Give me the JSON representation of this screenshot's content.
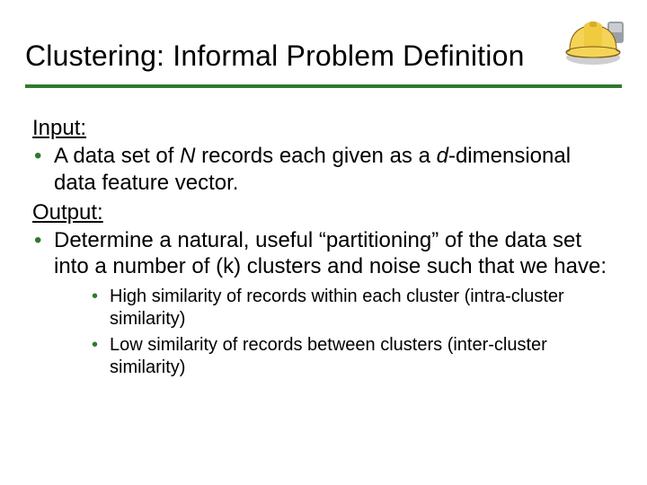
{
  "title": "Clustering: Informal Problem Definition",
  "icon": {
    "name": "hardhat-icon"
  },
  "body": {
    "input_label": "Input:",
    "input_bullet_pre": "A data set of ",
    "input_bullet_N": "N",
    "input_bullet_mid": " records each given as a ",
    "input_bullet_d": "d",
    "input_bullet_post": "-dimensional data feature vector.",
    "output_label": "Output:",
    "output_bullet": "Determine a natural, useful “partitioning” of the data set into a number of (k) clusters and noise such that we have:",
    "sub": [
      "High similarity of records within each cluster (intra-cluster similarity)",
      "Low similarity of records between clusters (inter-cluster similarity)"
    ]
  }
}
